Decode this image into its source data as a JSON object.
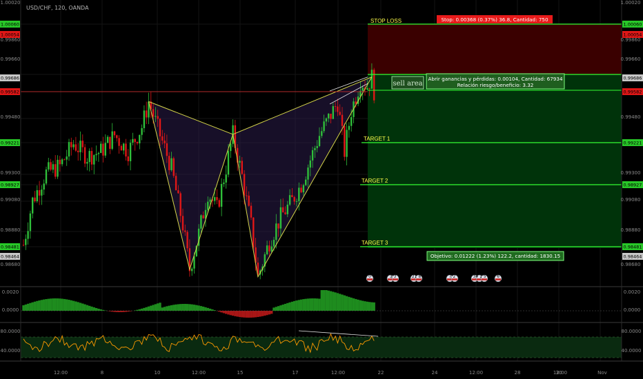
{
  "symbol": "USD/CHF, 120, OANDA",
  "colors": {
    "up": "#2fbf3a",
    "down": "#e01717",
    "pattern": "#d6d64a",
    "stop_zone": "#3a0000",
    "profit_zone": "#00330a",
    "level_green": "#33ff33",
    "stop_label_bg": "#e81a1a",
    "oscillator": "#ff9a00"
  },
  "trade": {
    "stop_loss_label": "STOP LOSS",
    "stop_info": "Stop: 0.00368 (0.37%) 36.8, Cantidad: 750",
    "open_info_line1": "Abrir ganancias y pérdidas: 0.00104, Cantidad: 67934",
    "open_info_line2": "Relación riesgo/beneficio: 3.32",
    "sell_area": "sell area",
    "target1": "TARGET 1",
    "target2": "TARGET 2",
    "target3": "TARGET 3",
    "target_info": "Objetivo: 0.01222 (1.23%) 122.2, cantidad: 1830.15"
  },
  "left_price_tags": [
    {
      "label": "1.00060",
      "color": "#28c828",
      "value": 1.0006
    },
    {
      "label": "1.00054",
      "color": "#e01717",
      "value": 1.00054
    },
    {
      "label": "0.99686",
      "color": "#c8c8c8",
      "value": 0.99686
    },
    {
      "label": "0.99582",
      "color": "#e01717",
      "value": 0.99582
    },
    {
      "label": "0.99221",
      "color": "#28c828",
      "value": 0.99221
    },
    {
      "label": "0.98927",
      "color": "#28c828",
      "value": 0.98927
    },
    {
      "label": "0.98481",
      "color": "#28c828",
      "value": 0.98481
    },
    {
      "label": "0.98464",
      "color": "#c8c8c8",
      "value": 0.98464
    }
  ],
  "right_price_tags": [
    {
      "label": "1.00060",
      "color": "#28c828",
      "value": 1.0006
    },
    {
      "label": "1.00054",
      "color": "#e01717",
      "value": 1.00054
    },
    {
      "label": "0.99686",
      "color": "#c8c8c8",
      "value": 0.99686
    },
    {
      "label": "0.99582",
      "color": "#e01717",
      "value": 0.99582
    },
    {
      "label": "0.99221",
      "color": "#28c828",
      "value": 0.99221
    },
    {
      "label": "0.98927",
      "color": "#28c828",
      "value": 0.98927
    },
    {
      "label": "0.98481",
      "color": "#28c828",
      "value": 0.98481
    },
    {
      "label": "0.98464",
      "color": "#c8c8c8",
      "value": 0.98464
    }
  ],
  "price_axis_ticks": [
    "1.00020",
    "0.99860",
    "0.99660",
    "0.99480",
    "0.99300",
    "0.99080",
    "0.98880",
    "0.98680"
  ],
  "indicator1": {
    "ticks": [
      "0.0020",
      "0.0000"
    ]
  },
  "indicator2": {
    "ticks": [
      "80.0000",
      "40.0000"
    ]
  },
  "x_axis_labels": [
    "12:00",
    "8",
    "10",
    "12:00",
    "15",
    "17",
    "12:00",
    "22",
    "24",
    "12:00",
    "28",
    "30",
    "12:00",
    "Nov"
  ],
  "event_markers": [
    {
      "text": "0"
    },
    {
      "text": "3 3"
    },
    {
      "text": "21 8"
    },
    {
      "text": "7 2"
    },
    {
      "text": "34 1 5"
    },
    {
      "text": "6"
    }
  ],
  "chart_data": {
    "type": "candlestick",
    "symbol": "USD/CHF",
    "timeframe": "120",
    "source": "OANDA",
    "price_range": [
      0.984,
      1.0012
    ],
    "pattern_points": [
      {
        "label": "X",
        "x_index": 55,
        "price": 0.99555
      },
      {
        "label": "A",
        "x_index": 73,
        "price": 0.9853
      },
      {
        "label": "B",
        "x_index": 92,
        "price": 0.99355
      },
      {
        "label": "C",
        "x_index": 103,
        "price": 0.98485
      },
      {
        "label": "D",
        "x_index": 153,
        "price": 0.99705
      }
    ],
    "levels": {
      "stop_loss": 1.0006,
      "entry": 0.99686,
      "target1": 0.99221,
      "target2": 0.98927,
      "target3": 0.98481
    }
  }
}
